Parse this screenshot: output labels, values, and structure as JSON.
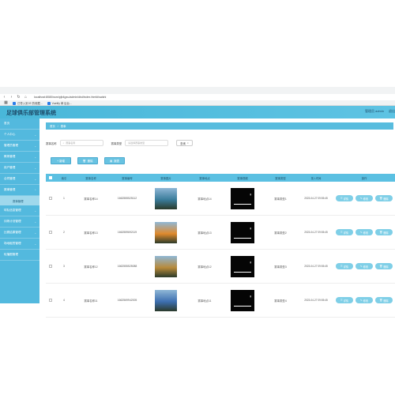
{
  "browser": {
    "url": "localhost:8080/ssm/pjb4gxu/admin/dist/index.html#/saishi",
    "bookmarks": [
      "已导入到 IE 的收藏...",
      "Vuetify 单 后台..."
    ]
  },
  "header": {
    "title": "足球俱乐部管理系统",
    "role": "管理员 admin",
    "logout": "退出"
  },
  "sidebar": {
    "items": [
      {
        "label": "首页"
      },
      {
        "label": "个人中心"
      },
      {
        "label": "管理员管理"
      },
      {
        "label": "教练管理"
      },
      {
        "label": "用户管理"
      },
      {
        "label": "合同管理"
      },
      {
        "label": "赛事管理"
      },
      {
        "label": "球队信息管理"
      },
      {
        "label": "训练计划管理"
      },
      {
        "label": "比赛结果管理"
      },
      {
        "label": "场地租赁管理"
      },
      {
        "label": "轮播图管理"
      }
    ],
    "active_sub": "赛事管理"
  },
  "breadcrumb": {
    "home": "首页",
    "current": "赛事"
  },
  "search": {
    "name_label": "赛事名称",
    "name_placeholder": "赛事名称",
    "type_label": "赛事类型",
    "type_placeholder": "请选择赛事类型",
    "query_button": "查询"
  },
  "actions": {
    "add": "+ 新增",
    "delete": "删除",
    "report": "报表"
  },
  "table": {
    "headers": [
      "索引",
      "赛事名称",
      "赛事编号",
      "赛事图片",
      "赛事地点",
      "赛事视频",
      "赛事类型",
      "录入时间",
      "操作"
    ],
    "rows": [
      {
        "idx": "1",
        "name": "赛事名称14",
        "no": "1662555525112",
        "place": "赛事地点14",
        "type": "赛事类型1",
        "time": "2023-04-27 09:55:45",
        "img": "#3a7c9a"
      },
      {
        "idx": "2",
        "name": "赛事名称13",
        "no": "1662559692119",
        "place": "赛事地点13",
        "type": "赛事类型2",
        "time": "2023-04-27 09:55:45",
        "img": "#e08a2c"
      },
      {
        "idx": "3",
        "name": "赛事名称12",
        "no": "1662555525088",
        "place": "赛事地点12",
        "type": "赛事类型3",
        "time": "2023-04-27 09:55:45",
        "img": "#b88a3a"
      },
      {
        "idx": "4",
        "name": "赛事名称11",
        "no": "1662569942005",
        "place": "赛事地点11",
        "type": "赛事类型4",
        "time": "2023-04-27 09:55:45",
        "img": "#3d6fb0"
      }
    ],
    "ops": {
      "detail": "详情",
      "edit": "修改",
      "delete": "删除"
    }
  }
}
